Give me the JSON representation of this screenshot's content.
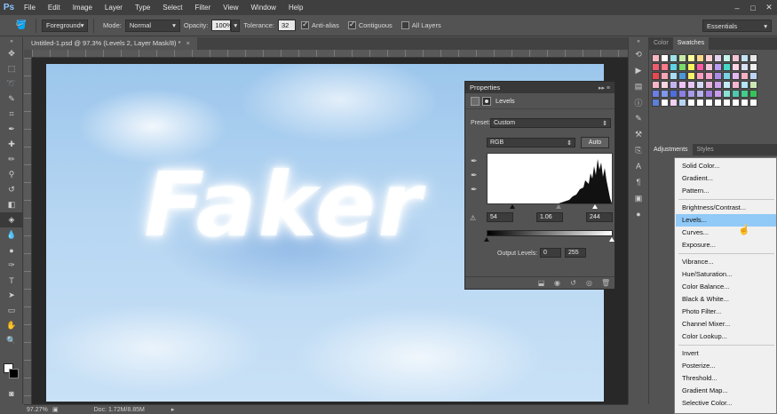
{
  "menubar": {
    "logo": "Ps",
    "items": [
      "File",
      "Edit",
      "Image",
      "Layer",
      "Type",
      "Select",
      "Filter",
      "View",
      "Window",
      "Help"
    ],
    "window_controls": [
      "–",
      "□",
      "✕"
    ]
  },
  "options": {
    "fill_source": "Foreground",
    "mode_label": "Mode:",
    "mode_value": "Normal",
    "opacity_label": "Opacity:",
    "opacity_value": "100%",
    "tolerance_label": "Tolerance:",
    "tolerance_value": "32",
    "antialias_label": "Anti-alias",
    "contiguous_label": "Contiguous",
    "all_layers_label": "All Layers",
    "workspace": "Essentials"
  },
  "document": {
    "tab_title": "Untitled-1.psd @ 97.3% (Levels 2, Layer Mask/8) *",
    "tab_close": "×",
    "canvas_text": "Faker"
  },
  "status": {
    "zoom": "97.27%",
    "doc_info": "Doc: 1.72M/8.85M"
  },
  "properties": {
    "title": "Properties",
    "menu_glyph": "▸▸ ≡",
    "adjustment_name": "Levels",
    "preset_label": "Preset:",
    "preset_value": "Custom",
    "channel_value": "RGB",
    "auto_label": "Auto",
    "input_black": "54",
    "input_gray": "1.06",
    "input_white": "244",
    "output_label": "Output Levels:",
    "output_black": "0",
    "output_white": "255"
  },
  "right_panel": {
    "tabs_top": [
      "Color",
      "Swatches"
    ],
    "tabs_adj": [
      "Adjustments",
      "Styles"
    ],
    "colors": {
      "swatches": [
        "#f7b6c0",
        "#ffffff",
        "#9fe3e8",
        "#c7e9a8",
        "#ffff9e",
        "#ffd78a",
        "#ffd0d4",
        "#e3d3f1",
        "#c5f4ea",
        "#f4c4d4",
        "#c4e3f7",
        "#e8e8e8",
        "#ee5d6f",
        "#ff7a8a",
        "#5fd4e6",
        "#77dc6a",
        "#fff35e",
        "#ff5aa3",
        "#f3c6da",
        "#b99cf6",
        "#46d8c8",
        "#ffd5e6",
        "#d8e2f4",
        "#f0f0f0",
        "#e8484f",
        "#f4a6b6",
        "#a8ddf5",
        "#4c98d6",
        "#f8f36c",
        "#ff9cc4",
        "#f7a7cd",
        "#ab8ce9",
        "#7bd0e6",
        "#e4b8f0",
        "#f2b2c2",
        "#bcd5f6",
        "#f5b7c8",
        "#f9d5e0",
        "#c3b4f0",
        "#efc4f4",
        "#e8c6f4",
        "#d6d8f8",
        "#e9b3df",
        "#cfa1ec",
        "#c5eaf6",
        "#f5b6d0",
        "#b4e4f5",
        "#cbe7b4",
        "#6a7ee3",
        "#7f98e8",
        "#4d6edb",
        "#8b7fe1",
        "#a89ae9",
        "#b5b0ef",
        "#a27ee3",
        "#c89ceb",
        "#8be2d3",
        "#4fc7ad",
        "#43cd8a",
        "#35c35a",
        "#5c80d8",
        "#ffffff",
        "#f1d1f0",
        "#b8d4f2",
        "#ffffff",
        "#ffffff",
        "#ffffff",
        "#ffffff",
        "#ffffff",
        "#ffffff",
        "#ffffff",
        "#ffffff"
      ]
    }
  },
  "adjust_menu": {
    "items": [
      "Solid Color...",
      "Gradient...",
      "Pattern...",
      "Brightness/Contrast...",
      "Levels...",
      "Curves...",
      "Exposure...",
      "Vibrance...",
      "Hue/Saturation...",
      "Color Balance...",
      "Black & White...",
      "Photo Filter...",
      "Channel Mixer...",
      "Color Lookup...",
      "Invert",
      "Posterize...",
      "Threshold...",
      "Gradient Map...",
      "Selective Color..."
    ],
    "highlighted": "Levels..."
  }
}
